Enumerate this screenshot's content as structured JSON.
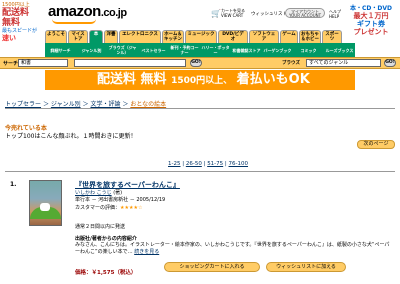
{
  "promo_left": {
    "line1": "1500円以上",
    "line2": "配送料",
    "line3": "無料",
    "line4": "最もスピードが",
    "line5": "速い",
    "line6": "配送",
    "line7": "ご利用！"
  },
  "logo": {
    "text": "amazon",
    "suffix": ".co.jp"
  },
  "top": {
    "cart_line1": "カートを見る",
    "cart_line2": "VIEW CART",
    "wishlist": "ウィッシュリスト",
    "account_line1": "マイアカウント",
    "account_line2": "YOUR ACCOUNT",
    "help_line1": "ヘルプ",
    "help_line2": "HELP"
  },
  "promo_right": {
    "l1": "本・CD・DVD",
    "l2": "最大１万円",
    "l3": "ギフト券",
    "l4": "プレゼント"
  },
  "tabs": [
    "ようこそ",
    "マイストア",
    "本",
    "洋書",
    "エレクトロニクス",
    "ホーム＆キッチン",
    "ミュージック",
    "DVD/ビデオ",
    "ソフトウェア",
    "ゲーム",
    "おもちゃ＆ホビー",
    "スポーツ"
  ],
  "subnav": [
    "詳細サーチ",
    "ジャンル別",
    "ブラウズ（ジャンル）",
    "ベストセラー",
    "新刊・予約コーナー",
    "ハリー・ポッター",
    "和書雑誌ストア",
    "バーゲンブック",
    "コミック",
    "ルーズブックス"
  ],
  "search": {
    "label": "サーチ",
    "category": "和書",
    "go": "GO!",
    "browse_label": "ブラウズ",
    "browse_value": "すべてのジャンル"
  },
  "banner": {
    "part1": "配送料 無料",
    "part2": "1500円以上、",
    "part3": "着払いもOK"
  },
  "breadcrumb": {
    "home": "トップセラー",
    "sep1": "＞",
    "cat1": "ジャンル別",
    "sep2": "＞",
    "cat2": "文学・評論",
    "sep3": "＞",
    "current": "おとなの絵本"
  },
  "section": {
    "title": "今売れている本",
    "desc": "トップ100はこんな顔ぶれ。１時間おきに更新！",
    "next": "次のページ"
  },
  "pager": {
    "p1": "1-25",
    "p2": "26-50",
    "p3": "51-75",
    "p4": "76-100",
    "sep": "|"
  },
  "product": {
    "rank": "1.",
    "title": "『世界を旅するペーパーわんこ』",
    "author": "いしかわ こうじ",
    "type": "(著)",
    "publisher": "単行本 － 河出書房新社 － 2005/12/19",
    "stars_label": "カスタマーの評価：",
    "stars": "★★★★☆",
    "shipping": "通常２日間以内に発送",
    "desc_head": "出版社/著者からの内容紹介",
    "desc": "みなさん、こんにちは。イラストレーター・絵本作家の、いしかわこうじです。『世界を旅するペーパーわんこ』は、紙製の小さな犬“ペーパーわんこ”の楽しい本で…",
    "more": "続きを見る",
    "price": "価格：￥1,575（税込）",
    "cart_btn": "ショッピングカートに入れる",
    "wish_btn": "ウィッシュリストに加える"
  }
}
